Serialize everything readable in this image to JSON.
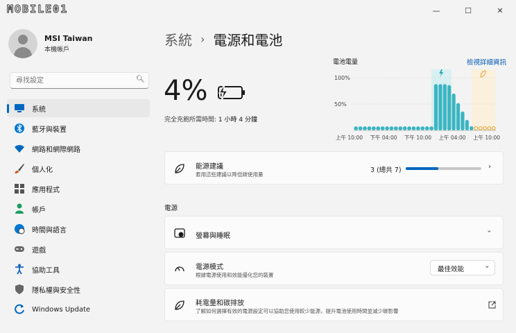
{
  "titlebar": {
    "logo": "MOBILE01",
    "minimize": "—",
    "maximize": "☐",
    "close": "✕"
  },
  "profile": {
    "name": "MSI Taiwan",
    "subtitle": "本機帳戶"
  },
  "search": {
    "placeholder": "尋找設定"
  },
  "nav": [
    {
      "label": "系統",
      "icon": "monitor-icon",
      "color": "#0067c0"
    },
    {
      "label": "藍牙與裝置",
      "icon": "bluetooth-icon",
      "color": "#0078d4"
    },
    {
      "label": "網路和網際網路",
      "icon": "wifi-icon",
      "color": "#0067c0"
    },
    {
      "label": "個人化",
      "icon": "brush-icon",
      "color": "#c55a11"
    },
    {
      "label": "應用程式",
      "icon": "apps-icon",
      "color": "#555"
    },
    {
      "label": "帳戶",
      "icon": "person-icon",
      "color": "#1a9e5f"
    },
    {
      "label": "時間與語言",
      "icon": "globe-clock-icon",
      "color": "#0078d4"
    },
    {
      "label": "遊戲",
      "icon": "gamepad-icon",
      "color": "#666"
    },
    {
      "label": "協助工具",
      "icon": "accessibility-icon",
      "color": "#1565c0"
    },
    {
      "label": "隱私權與安全性",
      "icon": "shield-icon",
      "color": "#666"
    },
    {
      "label": "Windows Update",
      "icon": "update-icon",
      "color": "#0067c0"
    }
  ],
  "breadcrumb": {
    "parent": "系統",
    "separator": "›",
    "current": "電源和電池"
  },
  "battery": {
    "percent": "4%",
    "charge_label": "完全充飽所需時間:",
    "charge_time": "1 小時 4 分鐘",
    "level": 0.04
  },
  "chart": {
    "title": "電池電量",
    "link": "檢視詳細資訊",
    "y_labels": [
      "100%",
      "50%"
    ],
    "x_labels": [
      "上午 10:00",
      "下午 04:00",
      "下午 10:00",
      "上午 04:00",
      "上午 10:00"
    ],
    "colors": {
      "bar": "#3bb5c2",
      "dot_future": "#e0a030",
      "band_charge": "#d8f0f2",
      "band_save": "#fbf0dc"
    }
  },
  "chart_data": {
    "type": "bar",
    "ylim": [
      0,
      100
    ],
    "values": [
      3,
      3,
      3,
      3,
      3,
      3,
      3,
      3,
      3,
      3,
      3,
      3,
      3,
      3,
      3,
      3,
      3,
      3,
      88,
      88,
      88,
      86,
      70,
      52,
      36,
      20,
      8,
      4,
      4,
      4,
      4,
      4
    ],
    "future_from_index": 27
  },
  "energy": {
    "title": "能源建議",
    "subtitle": "套用這些建議以降低碳使用量",
    "count": "3 (總共 7)",
    "progress": 0.43
  },
  "section_power": "電源",
  "screen_sleep": {
    "title": "螢幕與睡眠"
  },
  "power_mode": {
    "title": "電源模式",
    "subtitle": "根據電源使用和效能優化您的裝置",
    "value": "最佳效能"
  },
  "carbon": {
    "title": "耗電量和碳排放",
    "subtitle": "了解如何選擇有效的電源設定可以協助您使用較少能源，提升電池使用時間並減少碳影響"
  }
}
